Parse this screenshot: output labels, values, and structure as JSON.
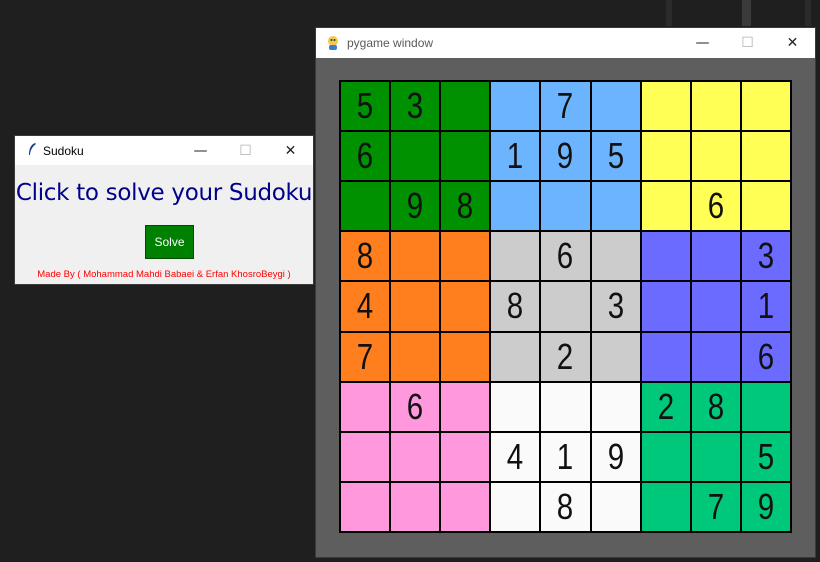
{
  "tk_window": {
    "title": "Sudoku",
    "heading": "Click to solve your Sudoku",
    "solve_label": "Solve",
    "credits": "Made By ( Mohammad Mahdi Babaei & Erfan KhosroBeygi )",
    "colors": {
      "heading": "#00008b",
      "button": "#008000",
      "credits": "#ff0000"
    }
  },
  "pygame_window": {
    "title": "pygame window"
  },
  "board": {
    "box_colors": [
      [
        "#009100",
        "#6db4ff",
        "#ffff55"
      ],
      [
        "#ff7f1e",
        "#cccccc",
        "#6b6bff"
      ],
      [
        "#ff98dc",
        "#fafafa",
        "#00c87a"
      ]
    ],
    "grid": [
      [
        "5",
        "3",
        "",
        "",
        "7",
        "",
        "",
        "",
        ""
      ],
      [
        "6",
        "",
        "",
        "1",
        "9",
        "5",
        "",
        "",
        ""
      ],
      [
        "",
        "9",
        "8",
        "",
        "",
        "",
        "",
        "6",
        ""
      ],
      [
        "8",
        "",
        "",
        "",
        "6",
        "",
        "",
        "",
        "3"
      ],
      [
        "4",
        "",
        "",
        "8",
        "",
        "3",
        "",
        "",
        "1"
      ],
      [
        "7",
        "",
        "",
        "",
        "2",
        "",
        "",
        "",
        "6"
      ],
      [
        "",
        "6",
        "",
        "",
        "",
        "",
        "2",
        "8",
        ""
      ],
      [
        "",
        "",
        "",
        "4",
        "1",
        "9",
        "",
        "",
        "5"
      ],
      [
        "",
        "",
        "",
        "",
        "8",
        "",
        "",
        "7",
        "9"
      ]
    ]
  }
}
